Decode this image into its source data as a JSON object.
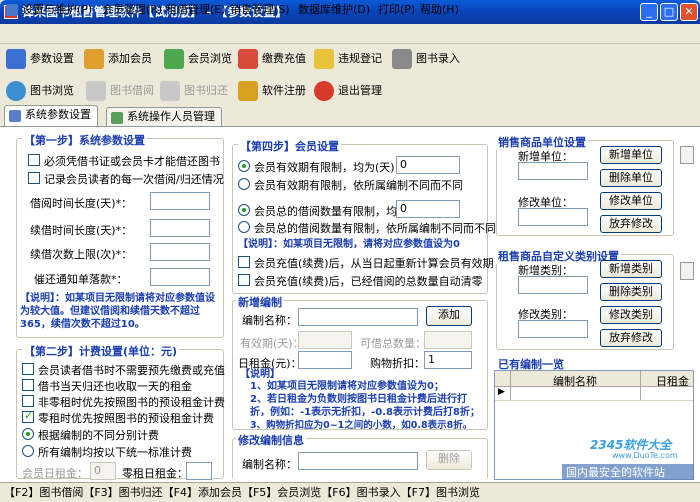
{
  "window": {
    "title": "锋采图书租售管理软件【试用版】 - 【参数设置】",
    "min": "_",
    "max": "□",
    "close": "✕"
  },
  "menu": [
    "设置与维护(P)",
    "会员管理(R)",
    "租借管理(E)",
    "销售管理(S)",
    "数据库维护(D)",
    "打印(P)",
    "帮助(H)"
  ],
  "toolbar1": [
    "参数设置",
    "添加会员",
    "会员浏览",
    "缴费充值",
    "违规登记",
    "图书录入"
  ],
  "toolbar2": [
    "图书浏览",
    "图书借阅",
    "图书归还",
    "软件注册",
    "退出管理"
  ],
  "tabs": [
    "系统参数设置",
    "系统操作人员管理"
  ],
  "step1": {
    "title": "【第一步】系统参数设置",
    "opt1": "必须凭借书证或会员卡才能借还图书",
    "opt2": "记录会员读者的每一次借阅/归还情况",
    "f1": "借阅时间长度(天)*：",
    "f2": "续借时间长度(天)*：",
    "f3": "续借次数上限(次)*：",
    "f4": "催还通知单落款*：",
    "note": "【说明】：如某项目无限制请将对应参数值设为较大值。但建议借阅和续借天数不超过365，续借次数不超过10。"
  },
  "step2": {
    "title": "【第二步】计费设置(单位：元)",
    "opt1": "会员读者借书时不需要预先缴费或充值",
    "opt2": "借书当天归还也收取一天的租金",
    "opt3": "非零租时优先按照图书的预设租金计费",
    "opt4": "零租时优先按照图书的预设租金计费",
    "r1": "根据编制的不同分别计费",
    "r2": "所有编制均按以下统一标准计费",
    "f1": "会员日租金：",
    "v1": "0",
    "f2": "零租日租金："
  },
  "step4": {
    "title": "【第四步】会员设置",
    "r1": "会员有效期有限制，均为(天)：",
    "v1": "0",
    "r2": "会员有效期有限制，依所属编制不同而不同",
    "r3": "会员总的借阅数量有限制，均为：",
    "v3": "0",
    "r4": "会员总的借阅数量有限制，依所属编制不同而不同",
    "note": "【说明】：如某项目无限制，请将对应参数值设为0",
    "c1": "会员充值(续费)后，从当日起重新计算会员有效期",
    "c2": "会员充值(续费)后，已经借阅的总数量自动清零"
  },
  "newcat": {
    "title": "新增编制",
    "name": "编制名称：",
    "add": "添加",
    "valid": "有效期(天)：",
    "borrow": "可借总数量：",
    "daily": "日租金(元)：",
    "discount": "购物折扣：",
    "discount_val": "1",
    "note_title": "【说明】",
    "notes": [
      "1、如某项目无限制请将对应参数值设为0；",
      "2、若日租金为负数则按图书日租金计费后进行打折，例如：-1表示无折扣，-0.8表示计费后打8折；",
      "3、购物折扣应为0~1之间的小数，如0.8表示8折。"
    ]
  },
  "editcat": {
    "title": "修改编制信息",
    "name": "编制名称：",
    "del": "删除"
  },
  "unit": {
    "title": "销售商品单位设置",
    "new_lbl": "新增单位：",
    "edit_lbl": "修改单位：",
    "b1": "新增单位",
    "b2": "删除单位",
    "b3": "修改单位",
    "b4": "放弃修改"
  },
  "cat": {
    "title": "租售商品自定义类别设置",
    "new_lbl": "新增类别：",
    "edit_lbl": "修改类别：",
    "b1": "新增类别",
    "b2": "删除类别",
    "b3": "修改类别",
    "b4": "放弃修改"
  },
  "existing": {
    "title": "已有编制一览",
    "cols": [
      "编制名称",
      "日租金"
    ],
    "marker": "▶"
  },
  "status": "【F2】图书借阅【F3】图书归还【F4】添加会员【F5】会员浏览【F6】图书录入【F7】图书浏览",
  "watermark": {
    "logo": "2345软件大全",
    "url": "www.DuoTe.com",
    "slogan": "国内最安全的软件站"
  }
}
